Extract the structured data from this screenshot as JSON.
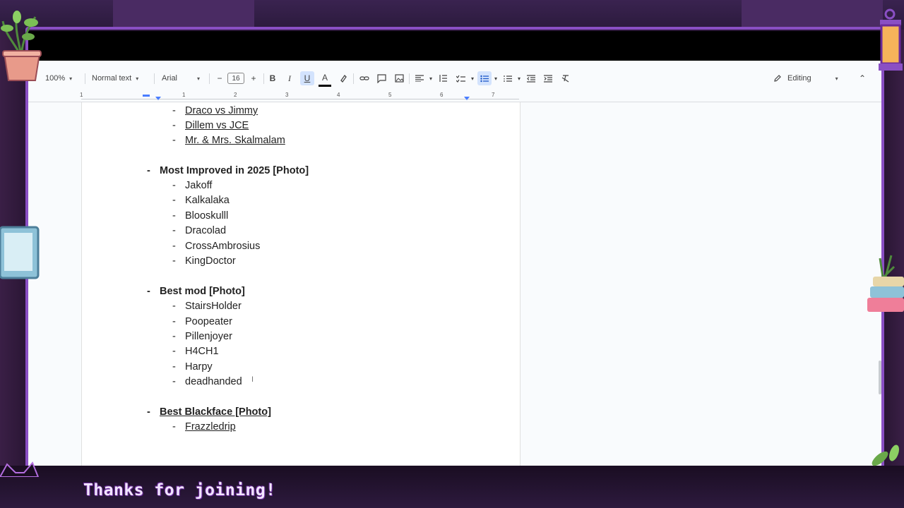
{
  "toolbar": {
    "zoom": "100%",
    "style": "Normal text",
    "font": "Arial",
    "font_size": "16",
    "minus": "−",
    "plus": "+",
    "bold": "B",
    "italic": "I",
    "underline": "U",
    "text_color": "A",
    "mode": "Editing",
    "caret": "▾",
    "collapse": "⌃"
  },
  "ruler": [
    "1",
    "1",
    "2",
    "3",
    "4",
    "5",
    "6",
    "7"
  ],
  "document": {
    "items_top": [
      "Draco vs Jimmy",
      "Dillem vs JCE",
      "Mr. & Mrs. Skalmalam"
    ],
    "sections": [
      {
        "title": "Most Improved in 2025 [Photo]",
        "items": [
          "Jakoff",
          "Kalkalaka",
          "Blooskulll",
          "Dracolad",
          "CrossAmbrosius",
          "KingDoctor"
        ]
      },
      {
        "title": "Best mod [Photo]",
        "items": [
          "StairsHolder",
          "Poopeater",
          "Pillenjoyer",
          "H4CH1",
          "Harpy",
          "deadhanded"
        ]
      },
      {
        "title": "Best Blackface [Photo]",
        "items": [
          "Frazzledrip"
        ]
      }
    ],
    "dash": "-"
  },
  "overlay": {
    "caption": "Thanks for joining!"
  },
  "colors": {
    "frame": "#8a4fc4",
    "caption": "#f1e4ff",
    "highlight": "#d3e3fd"
  }
}
